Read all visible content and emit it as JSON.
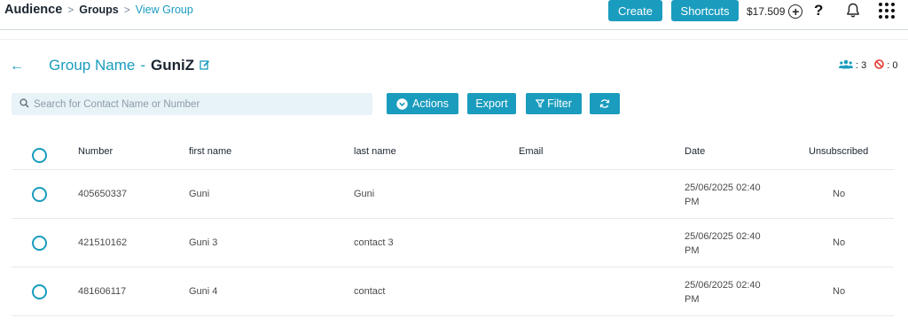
{
  "breadcrumb": {
    "root": "Audience",
    "sep1": ">",
    "mid": "Groups",
    "sep2": ">",
    "current": "View Group"
  },
  "toolbar": {
    "create": "Create",
    "shortcuts": "Shortcuts",
    "balance": "$17.509",
    "help": "?"
  },
  "header": {
    "back": "←",
    "label": "Group Name",
    "dash": "-",
    "name": "GuniZ",
    "members": ": 3",
    "blocked": ": 0"
  },
  "search": {
    "placeholder": "Search for Contact Name or Number"
  },
  "actions": {
    "actions": "Actions",
    "export": "Export",
    "filter": "Filter"
  },
  "columns": [
    "Number",
    "first name",
    "last name",
    "Email",
    "Date",
    "Unsubscribed"
  ],
  "rows": [
    {
      "number": "405650337",
      "first": "Guni",
      "last": "Guni",
      "email": "",
      "date1": "25/06/2025 02:40",
      "date2": "PM",
      "unsub": "No"
    },
    {
      "number": "421510162",
      "first": "Guni 3",
      "last": "contact 3",
      "email": "",
      "date1": "25/06/2025 02:40",
      "date2": "PM",
      "unsub": "No"
    },
    {
      "number": "481606117",
      "first": "Guni 4",
      "last": "contact",
      "email": "",
      "date1": "25/06/2025 02:40",
      "date2": "PM",
      "unsub": "No"
    }
  ],
  "colors": {
    "accent": "#1a9cbe",
    "blocked": "#e53935"
  }
}
